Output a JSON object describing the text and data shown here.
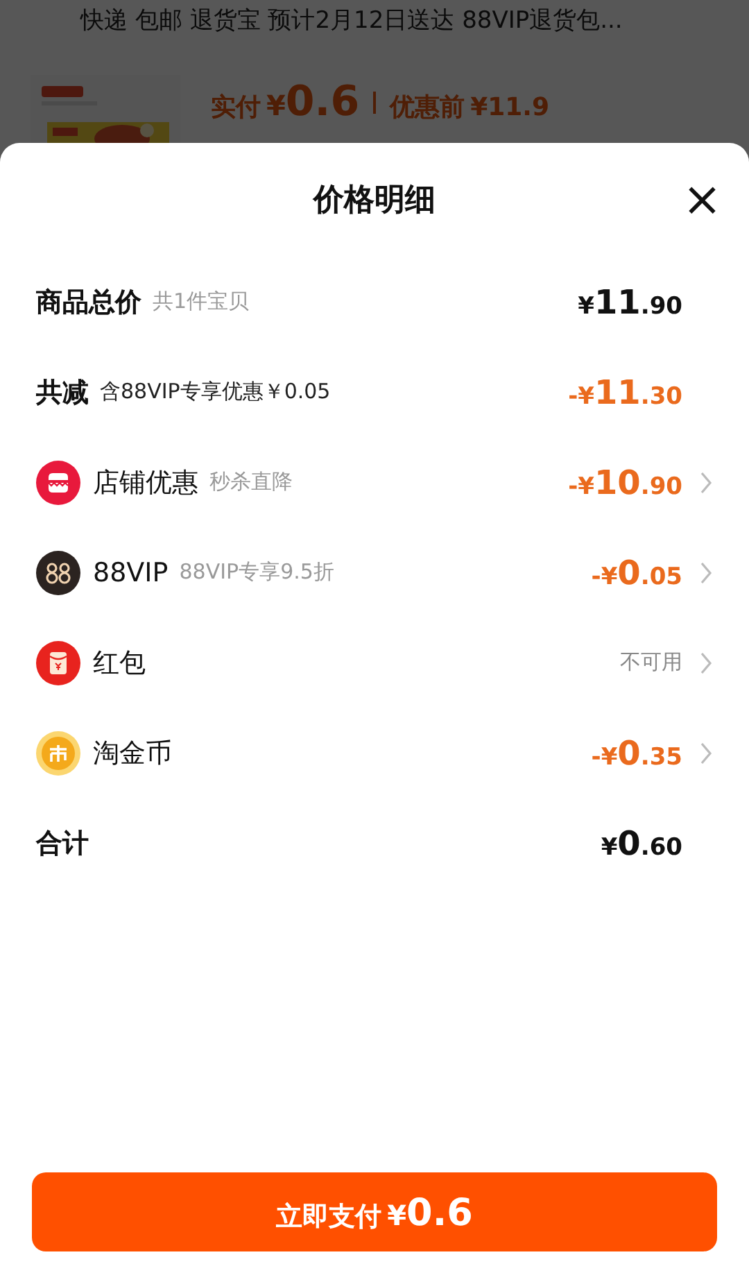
{
  "background_page": {
    "delivery_info": "快递 包邮 退货宝 预计2月12日送达 88VIP退货包...",
    "paid_label": "实付",
    "paid_currency": "¥",
    "paid_amount": "0.6",
    "original_label": "优惠前",
    "original_price": "¥11.9"
  },
  "sheet": {
    "title": "价格明细",
    "close": "×",
    "rows": [
      {
        "kind": "subtotal",
        "label": "商品总价",
        "note": "共1件宝贝",
        "amount": {
          "currency": "¥",
          "integer": "11",
          "decimal": ".90"
        },
        "arrow": false
      },
      {
        "kind": "reduction",
        "label": "共减",
        "note": "含88VIP专享优惠￥0.05",
        "amount": {
          "currency": "-¥",
          "integer": "11",
          "decimal": ".30"
        },
        "arrow": false
      },
      {
        "kind": "shop",
        "label": "店铺优惠",
        "note": "秒杀直降",
        "amount": {
          "currency": "-¥",
          "integer": "10",
          "decimal": ".90"
        },
        "arrow": true
      },
      {
        "kind": "vip",
        "label": "88VIP",
        "note": "88VIP专享9.5折",
        "amount": {
          "currency": "-¥",
          "integer": "0",
          "decimal": ".05"
        },
        "arrow": true
      },
      {
        "kind": "packet",
        "label": "红包",
        "status": "不可用",
        "arrow": true
      },
      {
        "kind": "coin",
        "label": "淘金币",
        "amount": {
          "currency": "-¥",
          "integer": "0",
          "decimal": ".35"
        },
        "arrow": true
      },
      {
        "kind": "total",
        "label": "合计",
        "amount": {
          "currency": "¥",
          "integer": "0",
          "decimal": ".60"
        },
        "arrow": false
      }
    ],
    "pay_button": {
      "label": "立即支付",
      "currency": "¥",
      "amount": "0.6"
    }
  }
}
